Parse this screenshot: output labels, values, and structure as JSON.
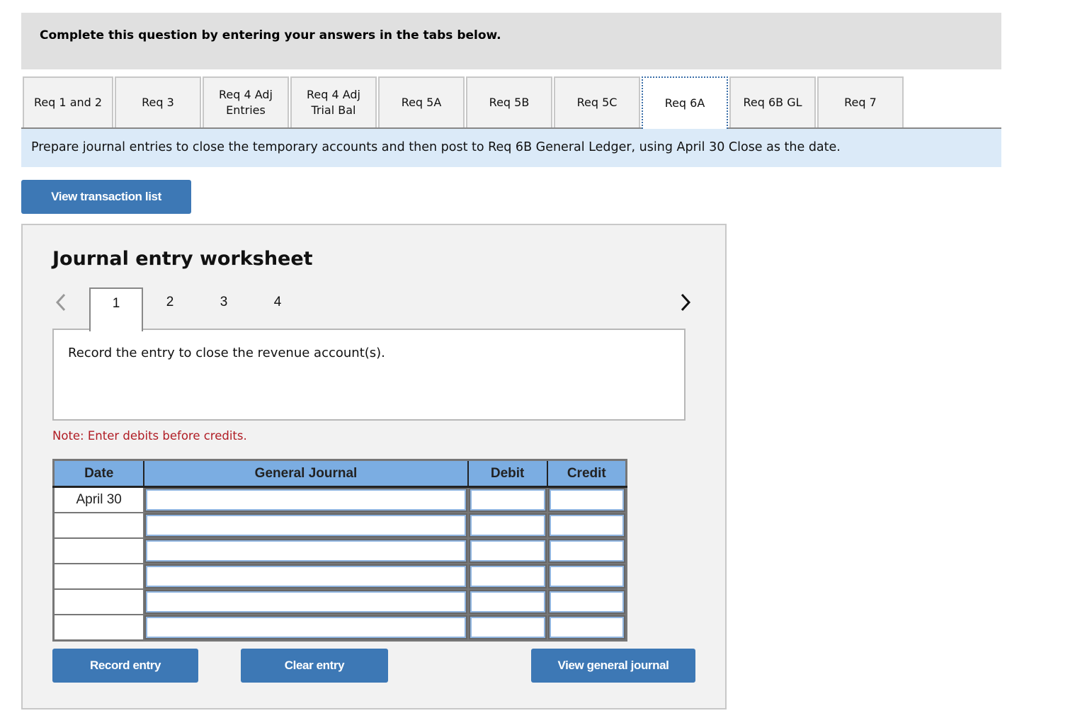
{
  "instruction": "Complete this question by entering your answers in the tabs below.",
  "tabs": [
    {
      "label": "Req 1 and 2",
      "active": false
    },
    {
      "label": "Req 3",
      "active": false
    },
    {
      "label": "Req 4 Adj\nEntries",
      "active": false
    },
    {
      "label": "Req 4 Adj\nTrial Bal",
      "active": false
    },
    {
      "label": "Req 5A",
      "active": false
    },
    {
      "label": "Req 5B",
      "active": false
    },
    {
      "label": "Req 5C",
      "active": false
    },
    {
      "label": "Req 6A",
      "active": true
    },
    {
      "label": "Req 6B GL",
      "active": false
    },
    {
      "label": "Req 7",
      "active": false
    }
  ],
  "prompt": "Prepare journal entries to close the temporary accounts and then post to Req 6B General Ledger, using April 30 Close as the date.",
  "view_transaction_list_label": "View transaction list",
  "worksheet": {
    "title": "Journal entry worksheet",
    "steps": [
      "1",
      "2",
      "3",
      "4"
    ],
    "active_step": "1",
    "description": "Record the entry to close the revenue account(s).",
    "note": "Note: Enter debits before credits.",
    "columns": [
      "Date",
      "General Journal",
      "Debit",
      "Credit"
    ],
    "rows": [
      {
        "date": "April 30",
        "account": "",
        "debit": "",
        "credit": ""
      },
      {
        "date": "",
        "account": "",
        "debit": "",
        "credit": ""
      },
      {
        "date": "",
        "account": "",
        "debit": "",
        "credit": ""
      },
      {
        "date": "",
        "account": "",
        "debit": "",
        "credit": ""
      },
      {
        "date": "",
        "account": "",
        "debit": "",
        "credit": ""
      },
      {
        "date": "",
        "account": "",
        "debit": "",
        "credit": ""
      }
    ],
    "buttons": {
      "record": "Record entry",
      "clear": "Clear entry",
      "view_general_journal": "View general journal"
    }
  },
  "colors": {
    "button_bg": "#3d78b5",
    "header_bg": "#7bade2",
    "prompt_bg": "#dbeaf8",
    "note_text": "#b01c24"
  }
}
